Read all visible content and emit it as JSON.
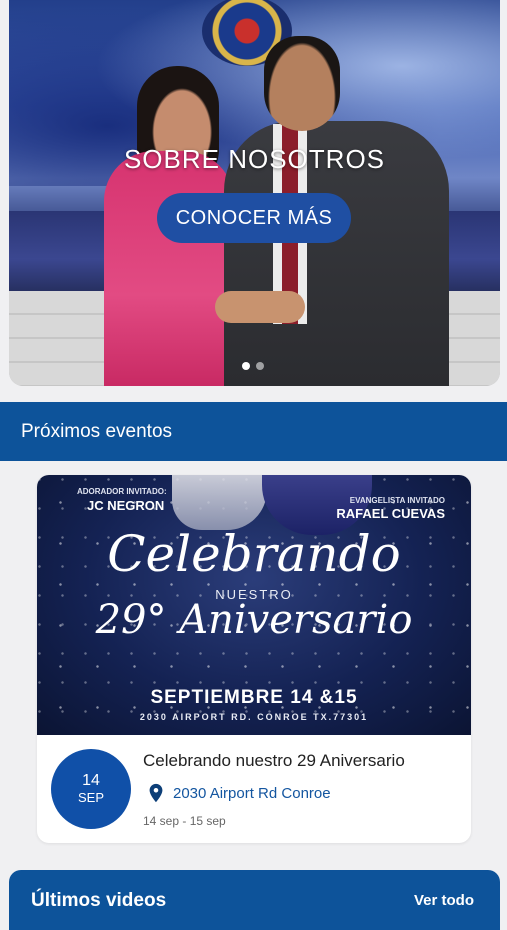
{
  "hero": {
    "title": "SOBRE NOSOTROS",
    "button_label": "CONOCER MÁS",
    "slides": 2,
    "active_slide": 1
  },
  "events_section": {
    "title": "Próximos eventos"
  },
  "event": {
    "flyer": {
      "guest1_role": "ADORADOR INVITADO:",
      "guest1_name": "JC NEGRON",
      "guest2_role": "EVANGELISTA INVITADO",
      "guest2_name": "RAFAEL CUEVAS",
      "line1": "Celebrando",
      "line2": "NUESTRO",
      "line3": "29° Aniversario",
      "dates": "SEPTIEMBRE 14 &15",
      "address": "2030 AIRPORT RD. CONROE TX.77301"
    },
    "day": "14",
    "month": "SEP",
    "title": "Celebrando nuestro 29 Aniversario",
    "location": "2030 Airport Rd Conroe",
    "date_range": "14 sep - 15 sep"
  },
  "next_section": {
    "title": "Últimos videos",
    "more": "Ver todo"
  },
  "colors": {
    "primary": "#0d539a",
    "badge": "#1050a8",
    "button": "#1f4fa3",
    "link": "#1456a0"
  },
  "icons": {
    "location": "map-pin-icon"
  }
}
